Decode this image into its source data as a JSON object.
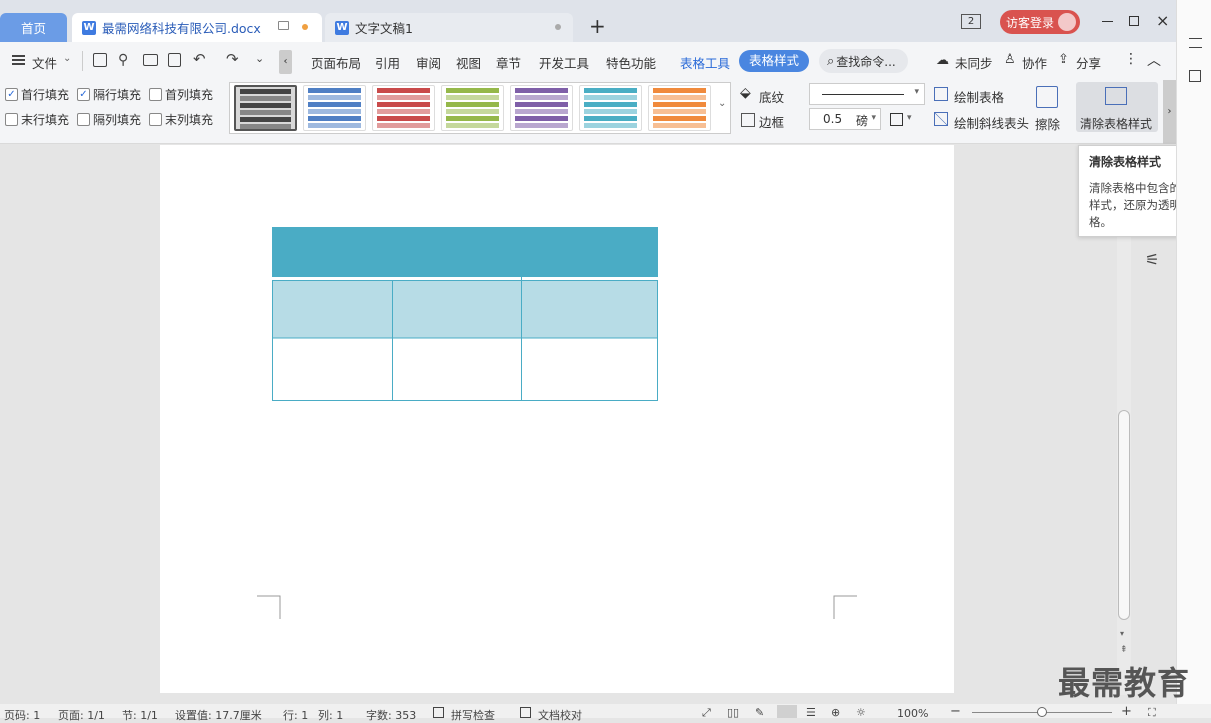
{
  "tabs": {
    "home": "首页",
    "doc1": "最需网络科技有限公司.docx",
    "doc2": "文字文稿1",
    "add": "+"
  },
  "window": {
    "badge": "2",
    "login": "访客登录"
  },
  "menu": {
    "file": "文件",
    "items": [
      "页面布局",
      "引用",
      "审阅",
      "视图",
      "章节",
      "开发工具",
      "特色功能"
    ],
    "table_tools": "表格工具",
    "table_style": "表格样式",
    "search": "查找命令...",
    "sync": "未同步",
    "collab": "协作",
    "share": "分享"
  },
  "ribbon": {
    "checkboxes": [
      {
        "label": "首行填充",
        "checked": true
      },
      {
        "label": "隔行填充",
        "checked": true
      },
      {
        "label": "首列填充",
        "checked": false
      },
      {
        "label": "末行填充",
        "checked": false
      },
      {
        "label": "隔列填充",
        "checked": false
      },
      {
        "label": "末列填充",
        "checked": false
      }
    ],
    "style_colors": [
      "#444444",
      "#4f7fc4",
      "#c94a4a",
      "#95b84a",
      "#7f5fa8",
      "#4aaec4",
      "#f08a3c"
    ],
    "shading": "底纹",
    "border": "边框",
    "line_width": "0.5",
    "unit": "磅",
    "draw_table": "绘制表格",
    "draw_diagonal": "绘制斜线表头",
    "erase": "擦除",
    "clear_style": "清除表格样式"
  },
  "tooltip": {
    "title": "清除表格样式",
    "body": "清除表格中包含的所有样式，还原为透明表格。"
  },
  "status": {
    "page_num": "页码: 1",
    "pages": "页面: 1/1",
    "section": "节: 1/1",
    "setting": "设置值: 17.7厘米",
    "row": "行: 1",
    "col": "列: 1",
    "words": "字数: 353",
    "spell": "拼写检查",
    "proof": "文档校对",
    "zoom": "100%"
  },
  "watermark": "最需教育",
  "colors": {
    "header": "#4aacc5",
    "band": "#b7dce6",
    "accent": "#3f7be0"
  }
}
